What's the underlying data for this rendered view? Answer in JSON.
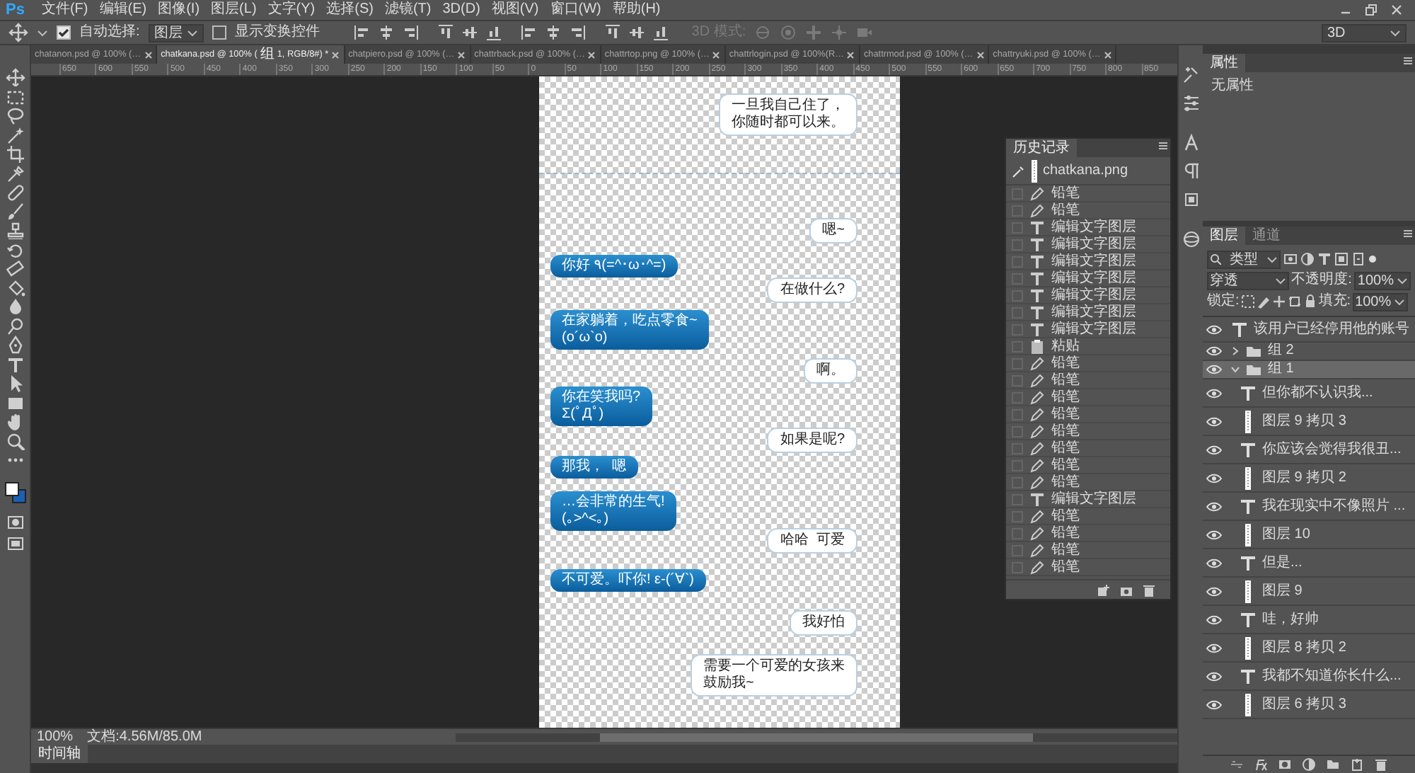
{
  "app": {
    "logo": "Ps",
    "menu": [
      "文件(F)",
      "编辑(E)",
      "图像(I)",
      "图层(L)",
      "文字(Y)",
      "选择(S)",
      "滤镜(T)",
      "3D(D)",
      "视图(V)",
      "窗口(W)",
      "帮助(H)"
    ]
  },
  "options_bar": {
    "auto_select": {
      "label": "自动选择:",
      "checked": true
    },
    "target": "图层",
    "show_transform": {
      "label": "显示变换控件",
      "checked": false
    },
    "mode": {
      "label": "3D 模式:",
      "disabled": true
    },
    "workspace": "3D"
  },
  "tabs": [
    {
      "label": "chatanon.psd @ 100% (…",
      "selected": false
    },
    {
      "label": "chatkana.psd @ 100% (组 1, RGB/8#) *",
      "selected": true
    },
    {
      "label": "chatpiero.psd @ 100% (…",
      "selected": false
    },
    {
      "label": "chattrback.psd @ 100% (…",
      "selected": false
    },
    {
      "label": "chattrtop.png @ 100% (…",
      "selected": false
    },
    {
      "label": "chattrlogin.psd @ 100%(R…",
      "selected": false
    },
    {
      "label": "chattrmod.psd @ 100% (…",
      "selected": false
    },
    {
      "label": "chattryuki.psd @ 100% (…",
      "selected": false
    }
  ],
  "ruler": {
    "labels": [
      "650",
      "600",
      "550",
      "500",
      "450",
      "400",
      "350",
      "300",
      "250",
      "200",
      "150",
      "100",
      "50",
      "0",
      "50",
      "100",
      "150",
      "200",
      "250",
      "300",
      "350",
      "400",
      "450",
      "500",
      "550",
      "600",
      "650",
      "700",
      "750",
      "800",
      "850"
    ]
  },
  "document": {
    "bubbles": [
      {
        "kind": "outgoing",
        "lines": [
          "一旦我自己住了，",
          "你随时都可以来。"
        ]
      },
      {
        "kind": "outgoing",
        "lines": [
          "嗯~"
        ]
      },
      {
        "kind": "incoming",
        "lines": [
          "你好 ٩(=^･ω･^=)"
        ]
      },
      {
        "kind": "outgoing",
        "lines": [
          "在做什么?"
        ]
      },
      {
        "kind": "incoming",
        "lines": [
          "在家躺着，吃点零食~",
          "(o´ω`o)"
        ]
      },
      {
        "kind": "outgoing",
        "lines": [
          "啊。"
        ]
      },
      {
        "kind": "incoming",
        "lines": [
          "你在笑我吗?",
          "Σ(ﾟДﾟ)"
        ]
      },
      {
        "kind": "outgoing",
        "lines": [
          "如果是呢?"
        ]
      },
      {
        "kind": "incoming",
        "lines": [
          "那我，  嗯"
        ]
      },
      {
        "kind": "incoming",
        "lines": [
          "…会非常的生气!",
          "(｡>^<｡)"
        ]
      },
      {
        "kind": "outgoing",
        "lines": [
          "哈哈  可爱"
        ]
      },
      {
        "kind": "incoming",
        "lines": [
          "不可爱。吓你! ε-(´∀`)"
        ]
      },
      {
        "kind": "outgoing",
        "lines": [
          "我好怕"
        ]
      },
      {
        "kind": "outgoing",
        "lines": [
          "需要一个可爱的女孩来",
          "鼓励我~"
        ]
      }
    ]
  },
  "history": {
    "title": "历史记录",
    "snapshot": "chatkana.png",
    "items": [
      {
        "kind": "pencil",
        "label": "铅笔"
      },
      {
        "kind": "pencil",
        "label": "铅笔"
      },
      {
        "kind": "type",
        "label": "编辑文字图层"
      },
      {
        "kind": "type",
        "label": "编辑文字图层"
      },
      {
        "kind": "type",
        "label": "编辑文字图层"
      },
      {
        "kind": "type",
        "label": "编辑文字图层"
      },
      {
        "kind": "type",
        "label": "编辑文字图层"
      },
      {
        "kind": "type",
        "label": "编辑文字图层"
      },
      {
        "kind": "type",
        "label": "编辑文字图层"
      },
      {
        "kind": "paste",
        "label": "粘贴"
      },
      {
        "kind": "pencil",
        "label": "铅笔"
      },
      {
        "kind": "pencil",
        "label": "铅笔"
      },
      {
        "kind": "pencil",
        "label": "铅笔"
      },
      {
        "kind": "pencil",
        "label": "铅笔"
      },
      {
        "kind": "pencil",
        "label": "铅笔"
      },
      {
        "kind": "pencil",
        "label": "铅笔"
      },
      {
        "kind": "pencil",
        "label": "铅笔"
      },
      {
        "kind": "pencil",
        "label": "铅笔"
      },
      {
        "kind": "type",
        "label": "编辑文字图层"
      },
      {
        "kind": "pencil",
        "label": "铅笔"
      },
      {
        "kind": "pencil",
        "label": "铅笔"
      },
      {
        "kind": "pencil",
        "label": "铅笔"
      },
      {
        "kind": "pencil",
        "label": "铅笔"
      }
    ]
  },
  "properties": {
    "title": "属性",
    "body": "无属性"
  },
  "layers": {
    "tabs": [
      {
        "label": "图层",
        "selected": true
      },
      {
        "label": "通道",
        "selected": false
      }
    ],
    "filter": "类型",
    "blend": "穿透",
    "opacity_label": "不透明度:",
    "opacity": "100%",
    "lock_label": "锁定:",
    "fill_label": "填充:",
    "fill": "100%",
    "items": [
      {
        "kind": "text",
        "name": "该用户已经停用他的账号",
        "selected": false
      },
      {
        "kind": "group",
        "name": "组 2",
        "expanded": false,
        "selected": false
      },
      {
        "kind": "group",
        "name": "组 1",
        "expanded": true,
        "selected": true,
        "children": [
          {
            "kind": "text",
            "name": "但你都不认识我...",
            "selected": false
          },
          {
            "kind": "image",
            "name": "图层 9 拷贝 3",
            "selected": false
          },
          {
            "kind": "text",
            "name": "你应该会觉得我很丑...",
            "selected": false
          },
          {
            "kind": "image",
            "name": "图层 9 拷贝 2",
            "selected": false
          },
          {
            "kind": "text",
            "name": "我在现实中不像照片 ...",
            "selected": false
          },
          {
            "kind": "image",
            "name": "图层 10",
            "selected": false
          },
          {
            "kind": "text",
            "name": "但是...",
            "selected": false
          },
          {
            "kind": "image",
            "name": "图层 9",
            "selected": false
          },
          {
            "kind": "text",
            "name": "哇，好帅",
            "selected": false
          },
          {
            "kind": "image",
            "name": "图层 8 拷贝 2",
            "selected": false
          },
          {
            "kind": "text",
            "name": "我都不知道你长什么...",
            "selected": false
          },
          {
            "kind": "image",
            "name": "图层 6 拷贝 3",
            "selected": false
          }
        ]
      }
    ]
  },
  "status_bar": {
    "zoom": "100%",
    "doc_size": "文档:4.56M/85.0M"
  },
  "timeline": {
    "label": "时间轴"
  }
}
